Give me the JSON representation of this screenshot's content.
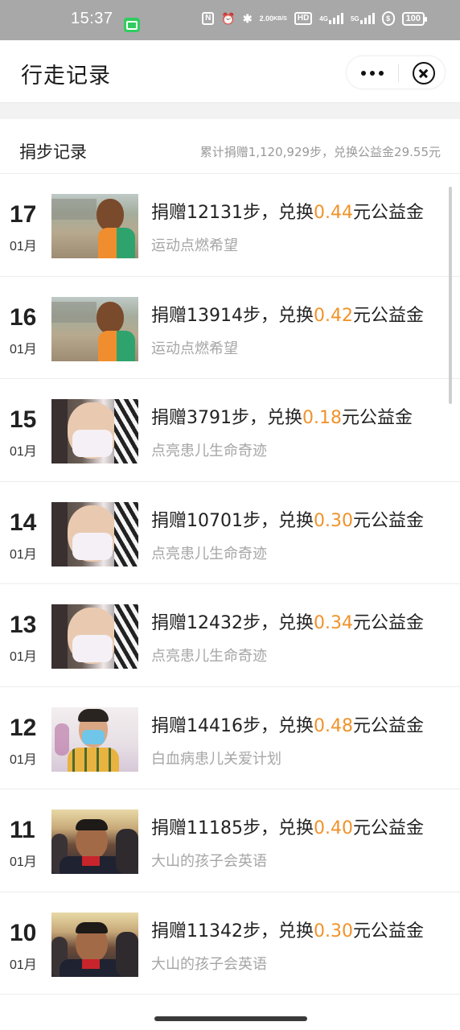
{
  "status_bar": {
    "time": "15:37",
    "icons": [
      "chat-app-icon",
      "nfc-icon",
      "alarm-icon",
      "bluetooth-icon"
    ],
    "net_speed_value": "2.00",
    "net_speed_unit": "KB/S",
    "hd_label": "HD",
    "signal1_label": "4G",
    "signal2_label": "5G",
    "battery": "100"
  },
  "title_bar": {
    "title": "行走记录"
  },
  "section": {
    "title": "捐步记录",
    "summary": "累计捐赠1,120,929步，兑换公益金29.55元"
  },
  "records": [
    {
      "day": "17",
      "month": "01月",
      "prefix": "捐赠12131步，兑换",
      "amount": "0.44",
      "suffix": "元公益金",
      "project": "运动点燃希望",
      "thumb": "boy-outdoor"
    },
    {
      "day": "16",
      "month": "01月",
      "prefix": "捐赠13914步，兑换",
      "amount": "0.42",
      "suffix": "元公益金",
      "project": "运动点燃希望",
      "thumb": "boy-outdoor"
    },
    {
      "day": "15",
      "month": "01月",
      "prefix": "捐赠3791步，兑换",
      "amount": "0.18",
      "suffix": "元公益金",
      "project": "点亮患儿生命奇迹",
      "thumb": "child-mask"
    },
    {
      "day": "14",
      "month": "01月",
      "prefix": "捐赠10701步，兑换",
      "amount": "0.30",
      "suffix": "元公益金",
      "project": "点亮患儿生命奇迹",
      "thumb": "child-mask"
    },
    {
      "day": "13",
      "month": "01月",
      "prefix": "捐赠12432步，兑换",
      "amount": "0.34",
      "suffix": "元公益金",
      "project": "点亮患儿生命奇迹",
      "thumb": "child-mask"
    },
    {
      "day": "12",
      "month": "01月",
      "prefix": "捐赠14416步，兑换",
      "amount": "0.48",
      "suffix": "元公益金",
      "project": "白血病患儿关爱计划",
      "thumb": "boy-blue-mask"
    },
    {
      "day": "11",
      "month": "01月",
      "prefix": "捐赠11185步，兑换",
      "amount": "0.40",
      "suffix": "元公益金",
      "project": "大山的孩子会英语",
      "thumb": "classroom-kids"
    },
    {
      "day": "10",
      "month": "01月",
      "prefix": "捐赠11342步，兑换",
      "amount": "0.30",
      "suffix": "元公益金",
      "project": "大山的孩子会英语",
      "thumb": "classroom-kids"
    }
  ],
  "colors": {
    "accent": "#f0932b",
    "status_bar_bg": "#a8a8a8",
    "divider": "#ececec"
  }
}
